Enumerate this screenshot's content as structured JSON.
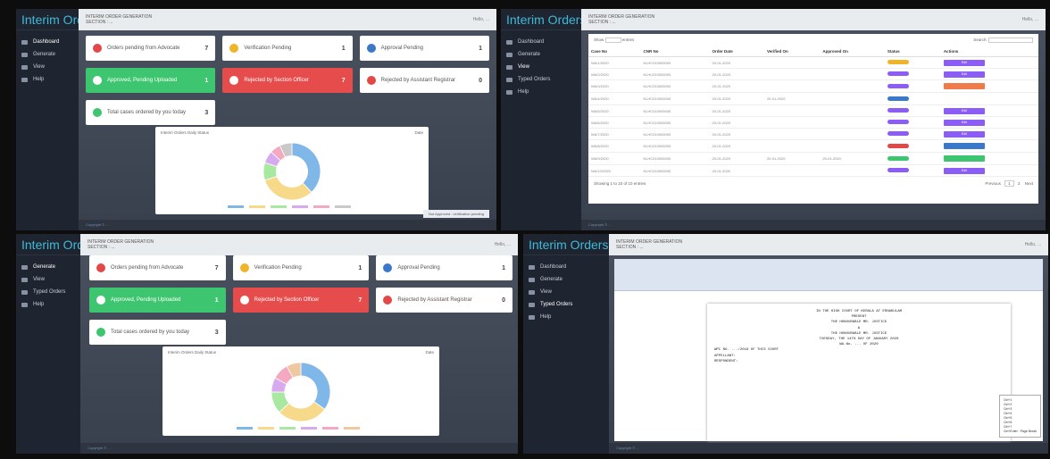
{
  "brand": "Interim Orders",
  "nav": [
    "Dashboard",
    "Generate",
    "View",
    "Typed Orders",
    "Help"
  ],
  "topbar": {
    "title_line1": "INTERIM ORDER GENERATION",
    "title_line2": "SECTION : ...",
    "user": "Hello, ..."
  },
  "cards": [
    {
      "label": "Orders pending from Advocate",
      "count": "7",
      "style": "plain",
      "icon": "advocate-icon",
      "color": "#e34848"
    },
    {
      "label": "Verification Pending",
      "count": "1",
      "style": "plain",
      "icon": "clock-icon",
      "color": "#f0b429"
    },
    {
      "label": "Approval Pending",
      "count": "1",
      "style": "plain",
      "icon": "approval-icon",
      "color": "#3a78c9"
    },
    {
      "label": "Approved, Pending Uploaded",
      "count": "1",
      "style": "green",
      "icon": "upload-icon",
      "color": "#ffffff"
    },
    {
      "label": "Rejected by Section Officer",
      "count": "7",
      "style": "red",
      "icon": "reject-icon",
      "color": "#ffffff"
    },
    {
      "label": "Rejected by Assistant Registrar",
      "count": "0",
      "style": "plain",
      "icon": "reject-ar-icon",
      "color": "#e34848"
    },
    {
      "label": "Total cases ordered by you today",
      "count": "3",
      "style": "plain",
      "icon": "check-icon",
      "color": "#3ec56f"
    }
  ],
  "chart1": {
    "title": "Interim Orders Daily Status",
    "date_label": "Date"
  },
  "notice": "Not Approved : verification pending",
  "footer": "Copyright © ...",
  "table": {
    "show_label": "Show",
    "entries_label": "entries",
    "search_label": "Search:",
    "headers": [
      "Case No",
      "CNR No",
      "Order Date",
      "Verified On",
      "Approved On",
      "Status",
      "Actions"
    ],
    "rows": [
      {
        "case": "WA/1/2020",
        "cnr": "KLHC010000000",
        "date": "20-01-2020",
        "ver": "",
        "app": "",
        "status_color": "#f0b429",
        "action": "Edit",
        "action_color": "#8b5cf6"
      },
      {
        "case": "WA/2/2020",
        "cnr": "KLHC010000000",
        "date": "20-01-2020",
        "ver": "",
        "app": "",
        "status_color": "#8b5cf6",
        "action": "Edit",
        "action_color": "#8b5cf6"
      },
      {
        "case": "WA/3/2020",
        "cnr": "KLHC010000000",
        "date": "20-01-2020",
        "ver": "",
        "app": "",
        "status_color": "#8b5cf6",
        "action": "",
        "action_color": "#f07a4a"
      },
      {
        "case": "WA/4/2020",
        "cnr": "KLHC010000000",
        "date": "20-01-2020",
        "ver": "20-01-2020",
        "app": "",
        "status_color": "#3a78c9",
        "action": "",
        "action_color": "#ffffff"
      },
      {
        "case": "WA/5/2020",
        "cnr": "KLHC010000000",
        "date": "20-01-2020",
        "ver": "",
        "app": "",
        "status_color": "#8b5cf6",
        "action": "Edit",
        "action_color": "#8b5cf6"
      },
      {
        "case": "WA/6/2020",
        "cnr": "KLHC010000000",
        "date": "20-01-2020",
        "ver": "",
        "app": "",
        "status_color": "#8b5cf6",
        "action": "Edit",
        "action_color": "#8b5cf6"
      },
      {
        "case": "WA/7/2020",
        "cnr": "KLHC010000000",
        "date": "20-01-2020",
        "ver": "",
        "app": "",
        "status_color": "#8b5cf6",
        "action": "Edit",
        "action_color": "#8b5cf6"
      },
      {
        "case": "WA/8/2020",
        "cnr": "KLHC010000000",
        "date": "20-01-2020",
        "ver": "",
        "app": "",
        "status_color": "#e34848",
        "action": "",
        "action_color": "#3a78c9"
      },
      {
        "case": "WA/9/2020",
        "cnr": "KLHC010000000",
        "date": "20-01-2020",
        "ver": "20-01-2020",
        "app": "20-01-2020",
        "status_color": "#3ec56f",
        "action": "",
        "action_color": "#3ec56f"
      },
      {
        "case": "WA/10/2020",
        "cnr": "KLHC010000000",
        "date": "20-01-2020",
        "ver": "",
        "app": "",
        "status_color": "#8b5cf6",
        "action": "Edit",
        "action_color": "#8b5cf6"
      }
    ],
    "info": "Showing 1 to 10 of 10 entries",
    "prev": "Previous",
    "page": "1",
    "page2": "2",
    "next": "Next"
  },
  "document": {
    "lines": [
      "IN THE HIGH COURT OF KERALA AT ERNAKULAM",
      "PRESENT",
      "THE HONOURABLE MR. JUSTICE",
      "&",
      "THE HONOURABLE MR. JUSTICE",
      "TUESDAY, THE 14TH DAY OF JANUARY 2020",
      "WA.No. ... OF 2020",
      "WPC NO. .../2019 OF THIS COURT",
      "APPELLANT:",
      "RESPONDENT:"
    ],
    "tooltip": [
      "Ctrl+1",
      "Ctrl+2",
      "Ctrl+3",
      "Ctrl+4",
      "Ctrl+5",
      "Ctrl+6",
      "Ctrl+7",
      "Ctrl+Enter : Page Break"
    ]
  },
  "donut1": [
    {
      "value": 38,
      "color": "#7fb8e8"
    },
    {
      "value": 32,
      "color": "#f7d98a"
    },
    {
      "value": 10,
      "color": "#a9e8a0"
    },
    {
      "value": 7,
      "color": "#d9a9f0"
    },
    {
      "value": 6,
      "color": "#f4a9c0"
    },
    {
      "value": 7,
      "color": "#c9c9c9"
    }
  ],
  "donut2": [
    {
      "value": 35,
      "color": "#7fb8e8"
    },
    {
      "value": 28,
      "color": "#f7d98a"
    },
    {
      "value": 12,
      "color": "#a9e8a0"
    },
    {
      "value": 8,
      "color": "#d9a9f0"
    },
    {
      "value": 9,
      "color": "#f4a9c0"
    },
    {
      "value": 8,
      "color": "#f0c8a0"
    }
  ]
}
